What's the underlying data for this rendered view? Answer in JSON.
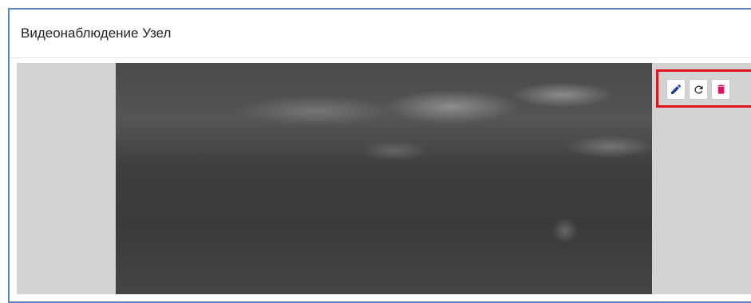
{
  "panel": {
    "title": "Видеонаблюдение Узел"
  },
  "toolbar": {
    "buttons": [
      {
        "icon": "pencil-icon",
        "color": "#1a3ea8"
      },
      {
        "icon": "refresh-icon",
        "color": "#222222"
      },
      {
        "icon": "trash-icon",
        "color": "#e0115f"
      }
    ],
    "highlight_color": "#e0151f"
  },
  "colors": {
    "panel_border": "#5b86c5",
    "video_background": "#d3d3d3"
  }
}
